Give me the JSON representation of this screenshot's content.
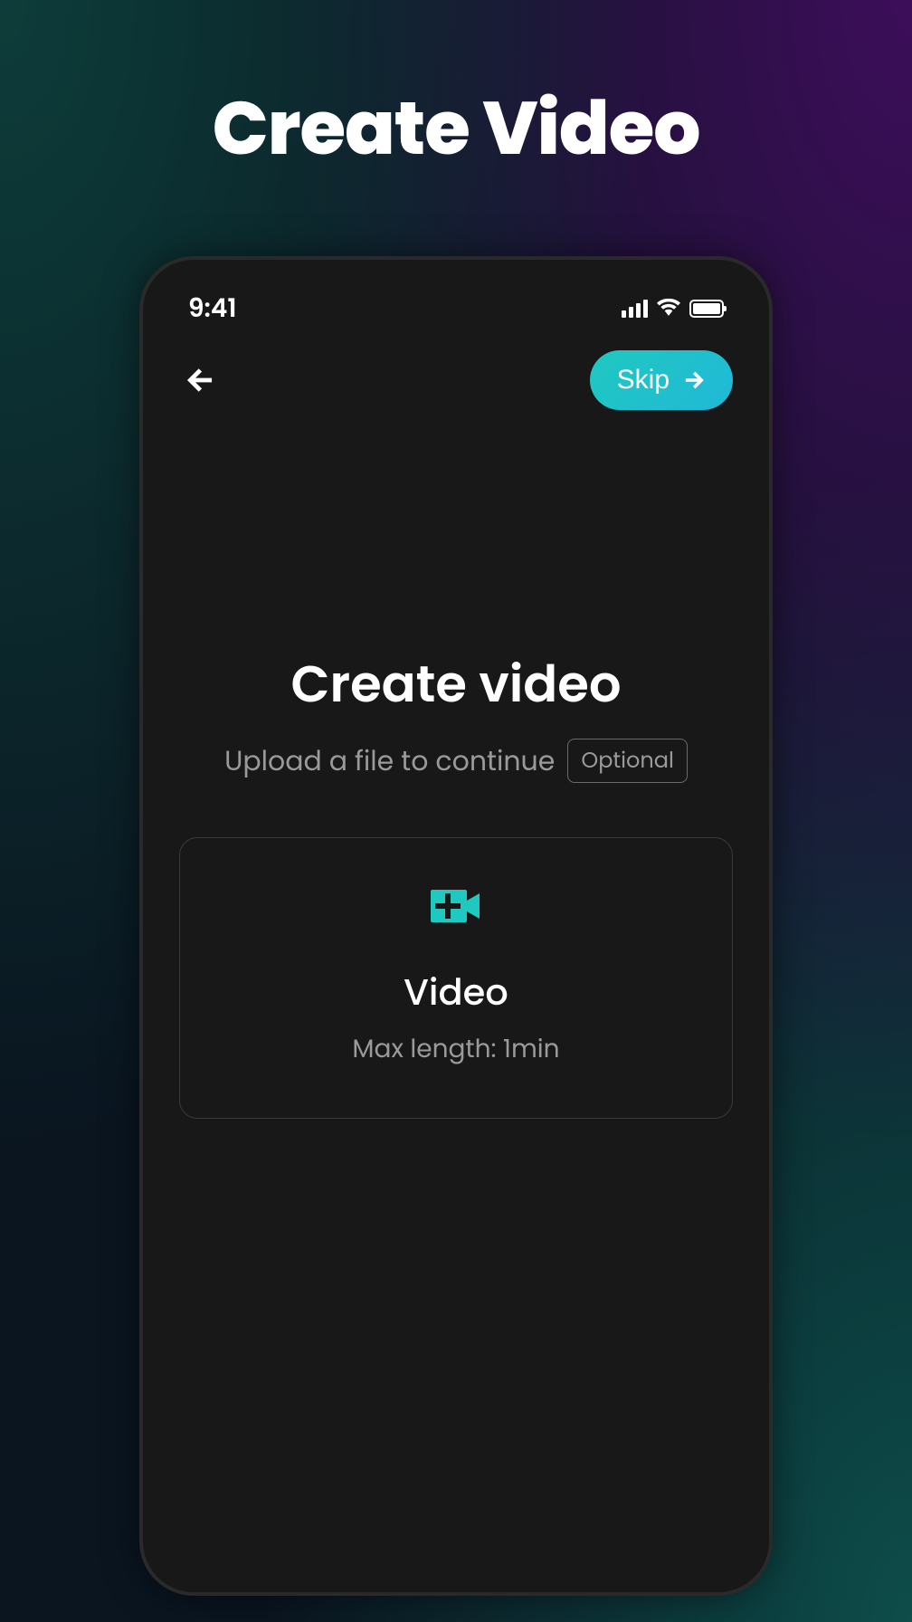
{
  "page": {
    "title": "Create Video"
  },
  "statusBar": {
    "time": "9:41"
  },
  "nav": {
    "skipLabel": "Skip"
  },
  "content": {
    "title": "Create video",
    "subtitle": "Upload a file to continue",
    "optionalBadge": "Optional"
  },
  "uploadCard": {
    "title": "Video",
    "subtitle": "Max length: 1min"
  },
  "colors": {
    "accent": "#1fc9c0",
    "background": "#181818",
    "textPrimary": "#ffffff",
    "textSecondary": "#9a9a9a"
  }
}
